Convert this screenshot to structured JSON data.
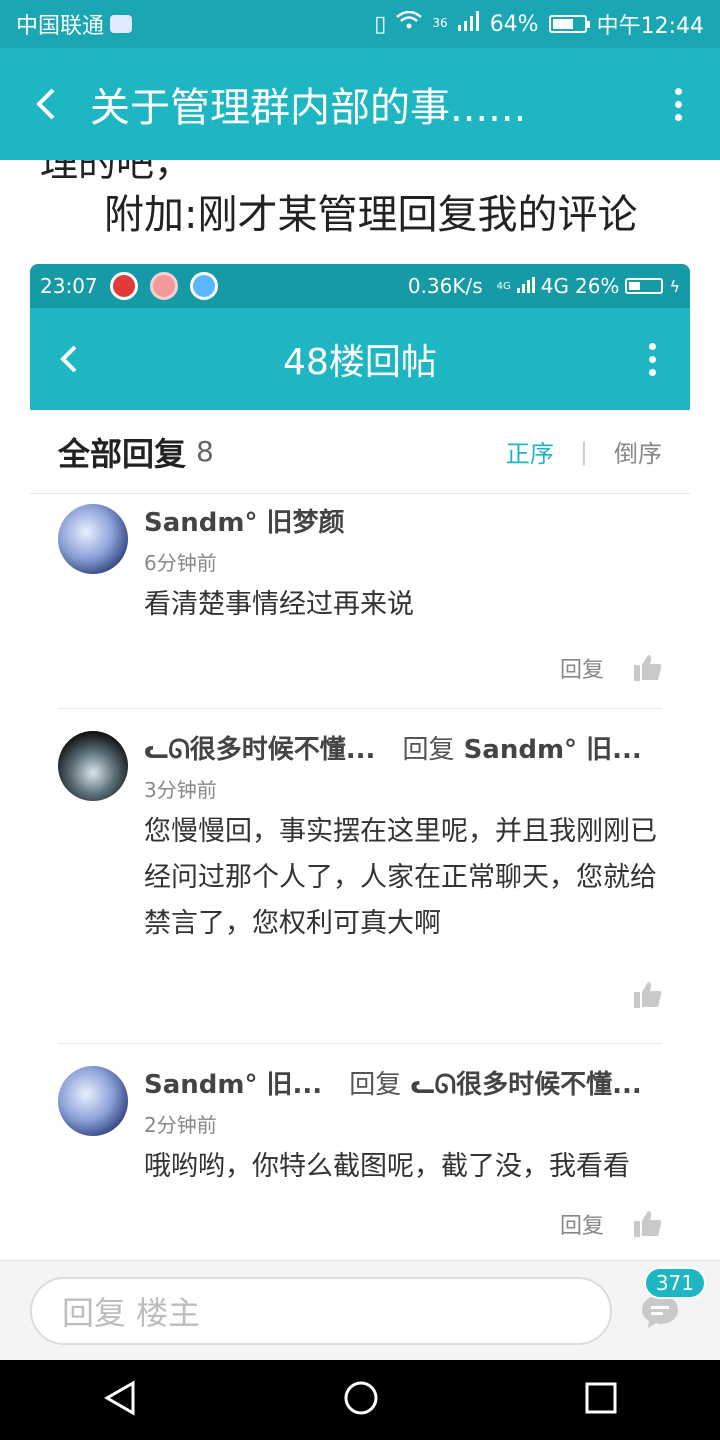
{
  "status_bar": {
    "carrier": "中国联通",
    "network": "36",
    "battery": "64%",
    "time": "中午12:44"
  },
  "app_bar": {
    "title": "关于管理群内部的事......"
  },
  "content": {
    "cut_text": "理的吧，",
    "text": "附加:刚才某管理回复我的评论"
  },
  "embedded_screenshot": {
    "status_bar": {
      "time": "23:07",
      "speed": "0.36K/s",
      "network_small": "4G",
      "network_label": "4G",
      "battery": "26%"
    },
    "app_bar": {
      "title": "48楼回帖"
    },
    "reply_header": {
      "title": "全部回复",
      "count": "8",
      "sort_asc": "正序",
      "sort_desc": "倒序"
    },
    "comments": [
      {
        "name": "Sandm° 旧梦颜",
        "reply_word": "",
        "reply_to": "",
        "time": "6分钟前",
        "text": "看清楚事情经过再来说",
        "reply_label": "回复"
      },
      {
        "name": "ᓚᘏ很多时候不懂...",
        "reply_word": "回复",
        "reply_to": "Sandm° 旧...",
        "time": "3分钟前",
        "text": "您慢慢回，事实摆在这里呢，并且我刚刚已经问过那个人了，人家在正常聊天，您就给禁言了，您权利可真大啊",
        "reply_label": ""
      },
      {
        "name": "Sandm° 旧...",
        "reply_word": "回复",
        "reply_to": "ᓚᘏ很多时候不懂...",
        "time": "2分钟前",
        "text": "哦哟哟，你特么截图呢，截了没，我看看",
        "reply_label": "回复"
      }
    ]
  },
  "bottom_bar": {
    "placeholder": "回复  楼主",
    "badge": "371"
  },
  "colors": {
    "accent": "#1fb6c4",
    "status": "#1ba6b3"
  }
}
